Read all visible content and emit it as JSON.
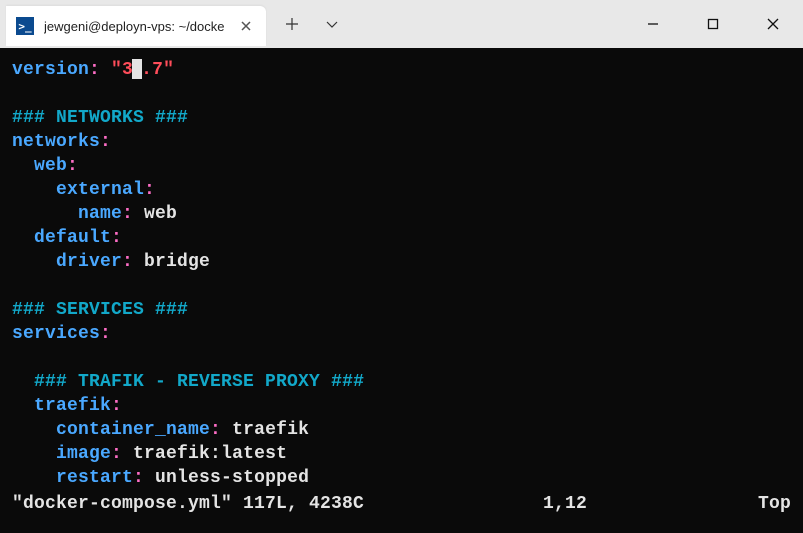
{
  "tab": {
    "icon_glyph": ">_",
    "title": "jewgeni@deployn-vps: ~/docke"
  },
  "code": {
    "lines": [
      {
        "indent": 0,
        "parts": [
          {
            "cls": "tok-key",
            "text": "version"
          },
          {
            "cls": "tok-colon",
            "text": ":"
          },
          {
            "cls": "tok-plain",
            "text": " "
          },
          {
            "cls": "tok-string",
            "text": "\"3"
          },
          {
            "cls": "cursor",
            "text": ""
          },
          {
            "cls": "tok-string",
            "text": ".7\""
          }
        ]
      },
      {
        "indent": 0,
        "parts": []
      },
      {
        "indent": 0,
        "parts": [
          {
            "cls": "tok-comment",
            "text": "### NETWORKS ###"
          }
        ]
      },
      {
        "indent": 0,
        "parts": [
          {
            "cls": "tok-key",
            "text": "networks"
          },
          {
            "cls": "tok-colon",
            "text": ":"
          }
        ]
      },
      {
        "indent": 1,
        "parts": [
          {
            "cls": "tok-key",
            "text": "web"
          },
          {
            "cls": "tok-colon",
            "text": ":"
          }
        ]
      },
      {
        "indent": 2,
        "parts": [
          {
            "cls": "tok-key",
            "text": "external"
          },
          {
            "cls": "tok-colon",
            "text": ":"
          }
        ]
      },
      {
        "indent": 3,
        "parts": [
          {
            "cls": "tok-key",
            "text": "name"
          },
          {
            "cls": "tok-colon",
            "text": ":"
          },
          {
            "cls": "tok-plain",
            "text": " web"
          }
        ]
      },
      {
        "indent": 1,
        "parts": [
          {
            "cls": "tok-key",
            "text": "default"
          },
          {
            "cls": "tok-colon",
            "text": ":"
          }
        ]
      },
      {
        "indent": 2,
        "parts": [
          {
            "cls": "tok-key",
            "text": "driver"
          },
          {
            "cls": "tok-colon",
            "text": ":"
          },
          {
            "cls": "tok-plain",
            "text": " bridge"
          }
        ]
      },
      {
        "indent": 0,
        "parts": []
      },
      {
        "indent": 0,
        "parts": [
          {
            "cls": "tok-comment",
            "text": "### SERVICES ###"
          }
        ]
      },
      {
        "indent": 0,
        "parts": [
          {
            "cls": "tok-key",
            "text": "services"
          },
          {
            "cls": "tok-colon",
            "text": ":"
          }
        ]
      },
      {
        "indent": 0,
        "parts": []
      },
      {
        "indent": 1,
        "parts": [
          {
            "cls": "tok-comment",
            "text": "### TRAFIK - REVERSE PROXY ###"
          }
        ]
      },
      {
        "indent": 1,
        "parts": [
          {
            "cls": "tok-key",
            "text": "traefik"
          },
          {
            "cls": "tok-colon",
            "text": ":"
          }
        ]
      },
      {
        "indent": 2,
        "parts": [
          {
            "cls": "tok-key",
            "text": "container_name"
          },
          {
            "cls": "tok-colon",
            "text": ":"
          },
          {
            "cls": "tok-plain",
            "text": " traefik"
          }
        ]
      },
      {
        "indent": 2,
        "parts": [
          {
            "cls": "tok-key",
            "text": "image"
          },
          {
            "cls": "tok-colon",
            "text": ":"
          },
          {
            "cls": "tok-plain",
            "text": " traefik:latest"
          }
        ]
      },
      {
        "indent": 2,
        "parts": [
          {
            "cls": "tok-key",
            "text": "restart"
          },
          {
            "cls": "tok-colon",
            "text": ":"
          },
          {
            "cls": "tok-plain",
            "text": " unless-stopped"
          }
        ]
      }
    ]
  },
  "status": {
    "left": "\"docker-compose.yml\" 117L, 4238C",
    "cursor_pos": "1,12",
    "scroll": "Top"
  }
}
